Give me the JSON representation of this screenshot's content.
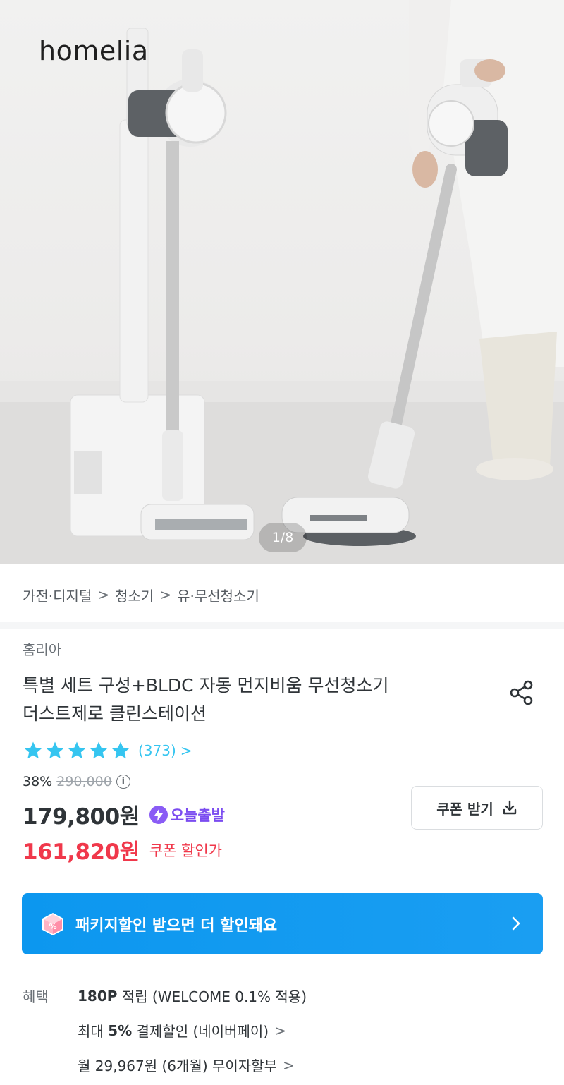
{
  "hero": {
    "brand_logo": "homelia",
    "image_counter": "1/8"
  },
  "breadcrumb": [
    "가전·디지털",
    "청소기",
    "유·무선청소기"
  ],
  "seller": "홈리아",
  "product": {
    "title_line1": "특별 세트 구성+BLDC 자동 먼지비움 무선청소기",
    "title_line2": "더스트제로 클린스테이션",
    "rating": 5,
    "review_count": "(373)",
    "discount_rate": "38%",
    "original_price": "290,000",
    "price": "179,800원",
    "today_delivery": "오늘출발",
    "coupon_price": "161,820원",
    "coupon_price_label": "쿠폰 할인가"
  },
  "coupon_button": {
    "label": "쿠폰 받기"
  },
  "package_banner": {
    "text": "패키지할인 받으면 더 할인돼요"
  },
  "benefits": {
    "label": "혜택",
    "points_bold": "180P",
    "points_rest": " 적립 (WELCOME 0.1% 적용)",
    "payment_prefix": "최대 ",
    "payment_bold": "5%",
    "payment_rest": " 결제할인 (네이버페이)",
    "installment": "월 29,967원 (6개월) 무이자할부"
  },
  "colors": {
    "accent_blue": "#35c5f0",
    "sale_red": "#f0384b",
    "today_purple": "#7b4cf0",
    "banner_blue": "#0c97ef"
  },
  "icons": {
    "share": "share-icon",
    "info": "info-icon",
    "download": "download-icon",
    "bolt": "bolt-icon",
    "package": "package-discount-icon",
    "star": "star-icon"
  }
}
